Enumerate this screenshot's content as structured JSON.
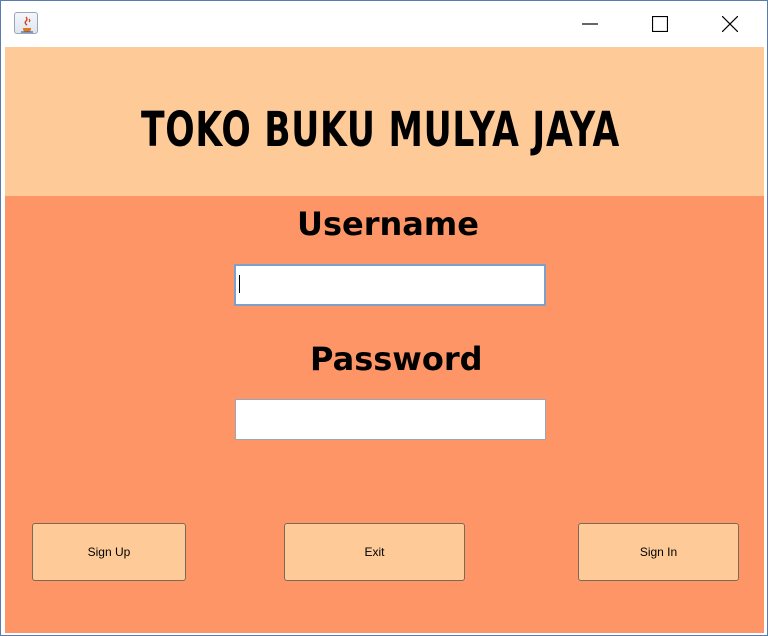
{
  "window": {
    "title_icon": "java-coffee-icon",
    "controls": {
      "minimize": "minimize-icon",
      "maximize": "maximize-icon",
      "close": "close-icon"
    }
  },
  "header": {
    "title": "TOKO BUKU MULYA JAYA"
  },
  "form": {
    "username_label": "Username",
    "username_value": "",
    "password_label": "Password",
    "password_value": ""
  },
  "buttons": {
    "sign_up": "Sign Up",
    "exit": "Exit",
    "sign_in": "Sign In"
  },
  "colors": {
    "header_bg": "#fecb98",
    "body_bg": "#fe9566",
    "button_bg": "#fecb98"
  }
}
